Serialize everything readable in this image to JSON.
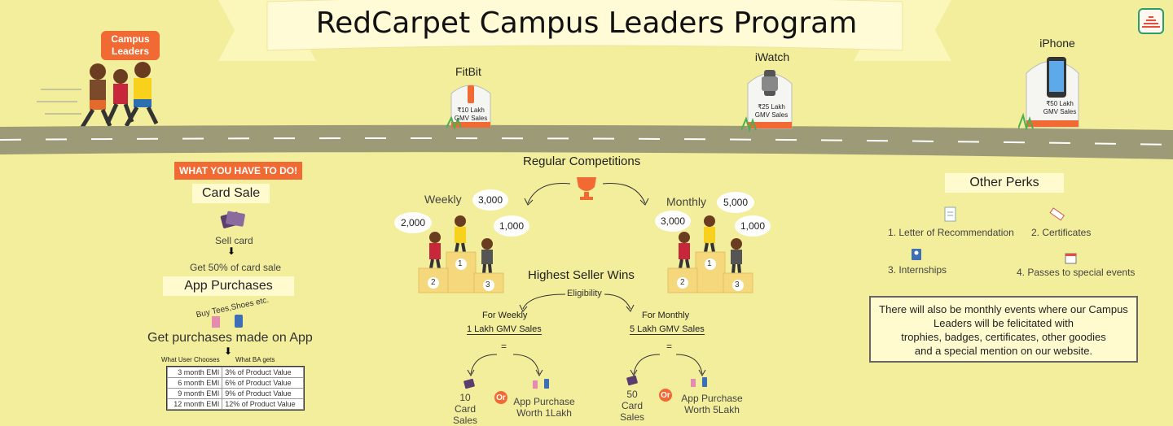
{
  "header": {
    "title": "RedCarpet Campus Leaders Program",
    "runner_bubble": [
      "Campus",
      "Leaders"
    ]
  },
  "milestones": [
    {
      "name": "FitBit",
      "stone": [
        "₹10 Lakh",
        "GMV Sales"
      ]
    },
    {
      "name": "iWatch",
      "stone": [
        "₹25 Lakh",
        "GMV Sales"
      ]
    },
    {
      "name": "iPhone",
      "stone": [
        "₹50 Lakh",
        "GMV Sales"
      ]
    }
  ],
  "todo": {
    "heading": "WHAT YOU HAVE TO DO!",
    "card_sale": {
      "title": "Card Sale",
      "step1": "Sell card",
      "step2": "Get 50% of card sale"
    },
    "app_purchases": {
      "title": "App Purchases",
      "curved": "Buy Tees,Shoes etc.",
      "line": "Get purchases made on App",
      "col1": "What User Chooses",
      "col2": "What BA gets",
      "rows": [
        [
          "3 month EMI",
          "3% of Product Value"
        ],
        [
          "6 month EMI",
          "6% of Product Value"
        ],
        [
          "9 month EMI",
          "9% of Product Value"
        ],
        [
          "12 month EMI",
          "12% of Product Value"
        ]
      ]
    }
  },
  "competitions": {
    "title": "Regular Competitions",
    "weekly": {
      "label": "Weekly",
      "first": "3,000",
      "second": "2,000",
      "third": "1,000"
    },
    "monthly": {
      "label": "Monthly",
      "first": "5,000",
      "second": "3,000",
      "third": "1,000"
    },
    "podium": {
      "p1": "1",
      "p2": "2",
      "p3": "3"
    },
    "highest": "Highest Seller Wins",
    "eligibility": "Eligibility",
    "for_weekly": {
      "label": "For Weekly",
      "req": "1 Lakh GMV Sales",
      "eq": "=",
      "card": [
        "10 Card",
        "Sales"
      ],
      "or": "Or",
      "app": [
        "App Purchase",
        "Worth 1Lakh"
      ]
    },
    "for_monthly": {
      "label": "For Monthly",
      "req": "5 Lakh GMV Sales",
      "eq": "=",
      "card": [
        "50 Card",
        "Sales"
      ],
      "or": "Or",
      "app": [
        "App Purchase",
        "Worth 5Lakh"
      ]
    }
  },
  "perks": {
    "title": "Other Perks",
    "items": [
      "1. Letter of Recommendation",
      "2. Certificates",
      "3. Internships",
      "4. Passes to special events"
    ],
    "note": [
      "There will also be monthly events where our Campus",
      "Leaders will be felicitated with",
      "trophies, badges, certificates, other goodies",
      "and a special mention on our website."
    ]
  },
  "colors": {
    "accent": "#f26a33",
    "background": "#f3ee9b",
    "road": "#9c9a77"
  }
}
